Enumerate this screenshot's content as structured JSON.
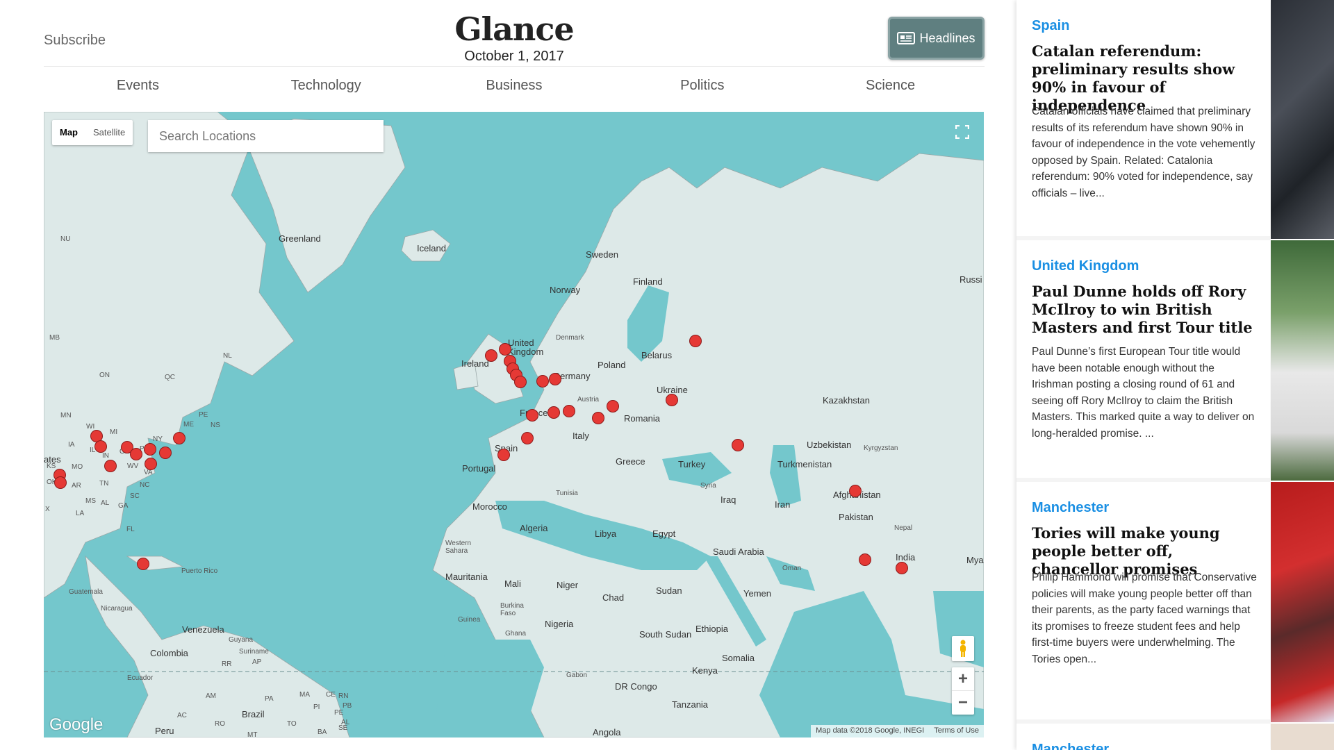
{
  "header": {
    "subscribe_label": "Subscribe",
    "brand_title": "Glance",
    "date": "October 1, 2017",
    "headlines_label": "Headlines"
  },
  "nav": {
    "items": [
      "Events",
      "Technology",
      "Business",
      "Politics",
      "Science"
    ]
  },
  "map": {
    "type_map": "Map",
    "type_satellite": "Satellite",
    "search_placeholder": "Search Locations",
    "logo": "Google",
    "attribution": "Map data ©2018 Google, INEGI",
    "terms": "Terms of Use",
    "zoom_in": "+",
    "zoom_out": "−",
    "water_color": "#74c7cc",
    "land_color": "#dde9e8",
    "marker_color": "#e53935",
    "labels": {
      "greenland": "Greenland",
      "iceland": "Iceland",
      "sweden": "Sweden",
      "norway": "Norway",
      "finland": "Finland",
      "russia": "Russi",
      "denmark": "Denmark",
      "united_kingdom": "United Kingdom",
      "ireland": "Ireland",
      "belarus": "Belarus",
      "poland": "Poland",
      "germany": "Germany",
      "ukraine": "Ukraine",
      "austria": "Austria",
      "france": "France",
      "romania": "Romania",
      "italy": "Italy",
      "spain": "Spain",
      "portugal": "Portugal",
      "greece": "Greece",
      "turkey": "Turkey",
      "kazakhstan": "Kazakhstan",
      "uzbekistan": "Uzbekistan",
      "kyrgyzstan": "Kyrgyzstan",
      "turkmenistan": "Turkmenistan",
      "afghanistan": "Afghanistan",
      "pakistan": "Pakistan",
      "iran": "Iran",
      "iraq": "Iraq",
      "syria": "Syria",
      "tunisia": "Tunisia",
      "morocco": "Morocco",
      "algeria": "Algeria",
      "libya": "Libya",
      "egypt": "Egypt",
      "saudi_arabia": "Saudi Arabia",
      "oman": "Oman",
      "yemen": "Yemen",
      "nepal": "Nepal",
      "india": "India",
      "myanmar": "Mya",
      "western_sahara": "Western Sahara",
      "mauritania": "Mauritania",
      "mali": "Mali",
      "niger": "Niger",
      "chad": "Chad",
      "sudan": "Sudan",
      "burkina_faso": "Burkina Faso",
      "guinea": "Guinea",
      "ghana": "Ghana",
      "nigeria": "Nigeria",
      "south_sudan": "South Sudan",
      "ethiopia": "Ethiopia",
      "somalia": "Somalia",
      "kenya": "Kenya",
      "gabon": "Gabon",
      "dr_congo": "DR Congo",
      "tanzania": "Tanzania",
      "angola": "Angola",
      "puerto_rico": "Puerto Rico",
      "guatemala": "Guatemala",
      "nicaragua": "Nicaragua",
      "venezuela": "Venezuela",
      "guyana": "Guyana",
      "suriname": "Suriname",
      "colombia": "Colombia",
      "ecuador": "Ecuador",
      "brazil": "Brazil",
      "peru": "Peru",
      "states": "ates",
      "nu": "NU",
      "mb": "MB",
      "on": "ON",
      "qc": "QC",
      "nl": "NL",
      "mn": "MN",
      "wi": "WI",
      "mi": "MI",
      "ny": "NY",
      "me": "ME",
      "pe": "PE",
      "ns": "NS",
      "ia": "IA",
      "il": "IL",
      "in": "IN",
      "oh": "OH",
      "pa": "PA",
      "wv": "WV",
      "va": "VA",
      "ks": "KS",
      "mo": "MO",
      "ok": "OK",
      "ar": "AR",
      "tn": "TN",
      "nc": "NC",
      "sc": "SC",
      "ms": "MS",
      "al": "AL",
      "ga": "GA",
      "tx": "X",
      "la": "LA",
      "fl": "FL",
      "rr": "RR",
      "ap": "AP",
      "am": "AM",
      "pa_br": "PA",
      "ma": "MA",
      "ce": "CE",
      "rn": "RN",
      "pi": "PI",
      "pb": "PB",
      "pe_br": "PE",
      "ac": "AC",
      "ro": "RO",
      "to": "TO",
      "al_br": "AL",
      "se": "SE",
      "ba": "BA",
      "mt": "MT"
    }
  },
  "news": [
    {
      "category": "Spain",
      "title": "Catalan referendum: preliminary results show 90% in favour of independence",
      "summary": "Catalan officials have claimed that preliminary results of its referendum have shown 90% in favour of independence in the vote vehemently opposed by Spain. Related: Catalonia referendum: 90% voted for independence, say officials – live..."
    },
    {
      "category": "United Kingdom",
      "title": "Paul Dunne holds off Rory McIlroy to win British Masters and first Tour title",
      "summary": "Paul Dunne’s first European Tour title would have been notable enough without the Irishman posting a closing round of 61 and seeing off Rory McIlroy to claim the British Masters. This marked quite a way to deliver on long-heralded promise. ..."
    },
    {
      "category": "Manchester",
      "title": "Tories will make young people better off, chancellor promises",
      "summary": "Philip Hammond will promise that Conservative policies will make young people better off than their parents, as the party faced warnings that its promises to freeze student fees and help first-time buyers were underwhelming. The Tories open..."
    },
    {
      "category": "Manchester",
      "title": "",
      "summary": ""
    }
  ]
}
